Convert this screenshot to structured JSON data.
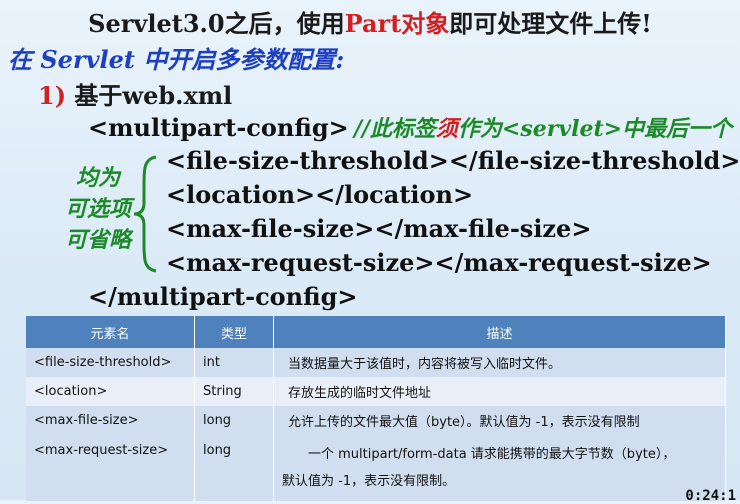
{
  "title": {
    "part1": "Servlet3.0之后，使用",
    "highlight": "Part对象",
    "part2": "即可处理文件上传!"
  },
  "subtitle": "在 Servlet 中开启多参数配置:",
  "item": {
    "num": "1)",
    "text": " 基于web.xml"
  },
  "code": {
    "open": "<multipart-config>",
    "comment_a": "//此标签",
    "comment_red": "须",
    "comment_b": "作为<servlet>中最后一个",
    "lines": [
      "<file-size-threshold></file-size-threshold>",
      "<location></location>",
      "<max-file-size></max-file-size>",
      "<max-request-size></max-request-size>"
    ],
    "close": "</multipart-config>"
  },
  "side_note": [
    "均为",
    "可选项",
    "可省略"
  ],
  "table": {
    "headers": [
      "元素名",
      "类型",
      "描述"
    ],
    "rows": [
      {
        "name": "<file-size-threshold>",
        "type": "int",
        "desc": "当数据量大于该值时，内容将被写入临时文件。"
      },
      {
        "name": "<location>",
        "type": "String",
        "desc": "存放生成的临时文件地址"
      },
      {
        "name": "<max-file-size>",
        "type": "long",
        "desc": "允许上传的文件最大值（byte）。默认值为 -1，表示没有限制"
      },
      {
        "name": "<max-request-size>",
        "type": "long",
        "desc": "一个 multipart/form-data 请求能携带的最大字节数（byte），",
        "desc2": "默认值为 -1，表示没有限制。"
      }
    ]
  },
  "clock": "0:24:1"
}
